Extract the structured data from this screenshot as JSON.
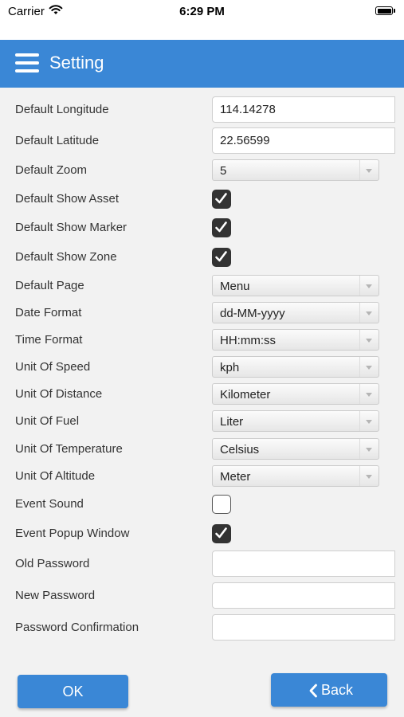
{
  "status_bar": {
    "carrier": "Carrier",
    "time": "6:29 PM"
  },
  "header": {
    "title": "Setting"
  },
  "fields": {
    "default_longitude": {
      "label": "Default Longitude",
      "value": "114.14278"
    },
    "default_latitude": {
      "label": "Default Latitude",
      "value": "22.56599"
    },
    "default_zoom": {
      "label": "Default Zoom",
      "value": "5"
    },
    "default_show_asset": {
      "label": "Default Show Asset",
      "checked": true
    },
    "default_show_marker": {
      "label": "Default Show Marker",
      "checked": true
    },
    "default_show_zone": {
      "label": "Default Show Zone",
      "checked": true
    },
    "default_page": {
      "label": "Default Page",
      "value": "Menu"
    },
    "date_format": {
      "label": "Date Format",
      "value": "dd-MM-yyyy"
    },
    "time_format": {
      "label": "Time Format",
      "value": "HH:mm:ss"
    },
    "unit_of_speed": {
      "label": "Unit Of Speed",
      "value": "kph"
    },
    "unit_of_distance": {
      "label": "Unit Of Distance",
      "value": "Kilometer"
    },
    "unit_of_fuel": {
      "label": "Unit Of Fuel",
      "value": "Liter"
    },
    "unit_of_temperature": {
      "label": "Unit Of Temperature",
      "value": "Celsius"
    },
    "unit_of_altitude": {
      "label": "Unit Of Altitude",
      "value": "Meter"
    },
    "event_sound": {
      "label": "Event Sound",
      "checked": false
    },
    "event_popup_window": {
      "label": "Event Popup Window",
      "checked": true
    },
    "old_password": {
      "label": "Old Password",
      "value": ""
    },
    "new_password": {
      "label": "New Password",
      "value": ""
    },
    "password_confirmation": {
      "label": "Password Confirmation",
      "value": ""
    }
  },
  "buttons": {
    "ok": "OK",
    "back": "Back"
  },
  "icons": {
    "menu": "hamburger-menu-icon",
    "back": "chevron-left-icon",
    "wifi": "wifi-icon",
    "battery": "battery-icon",
    "check": "checkmark-icon"
  },
  "colors": {
    "header": "#3a87d6",
    "button": "#3a87d6",
    "checkbox_checked": "#333333"
  }
}
